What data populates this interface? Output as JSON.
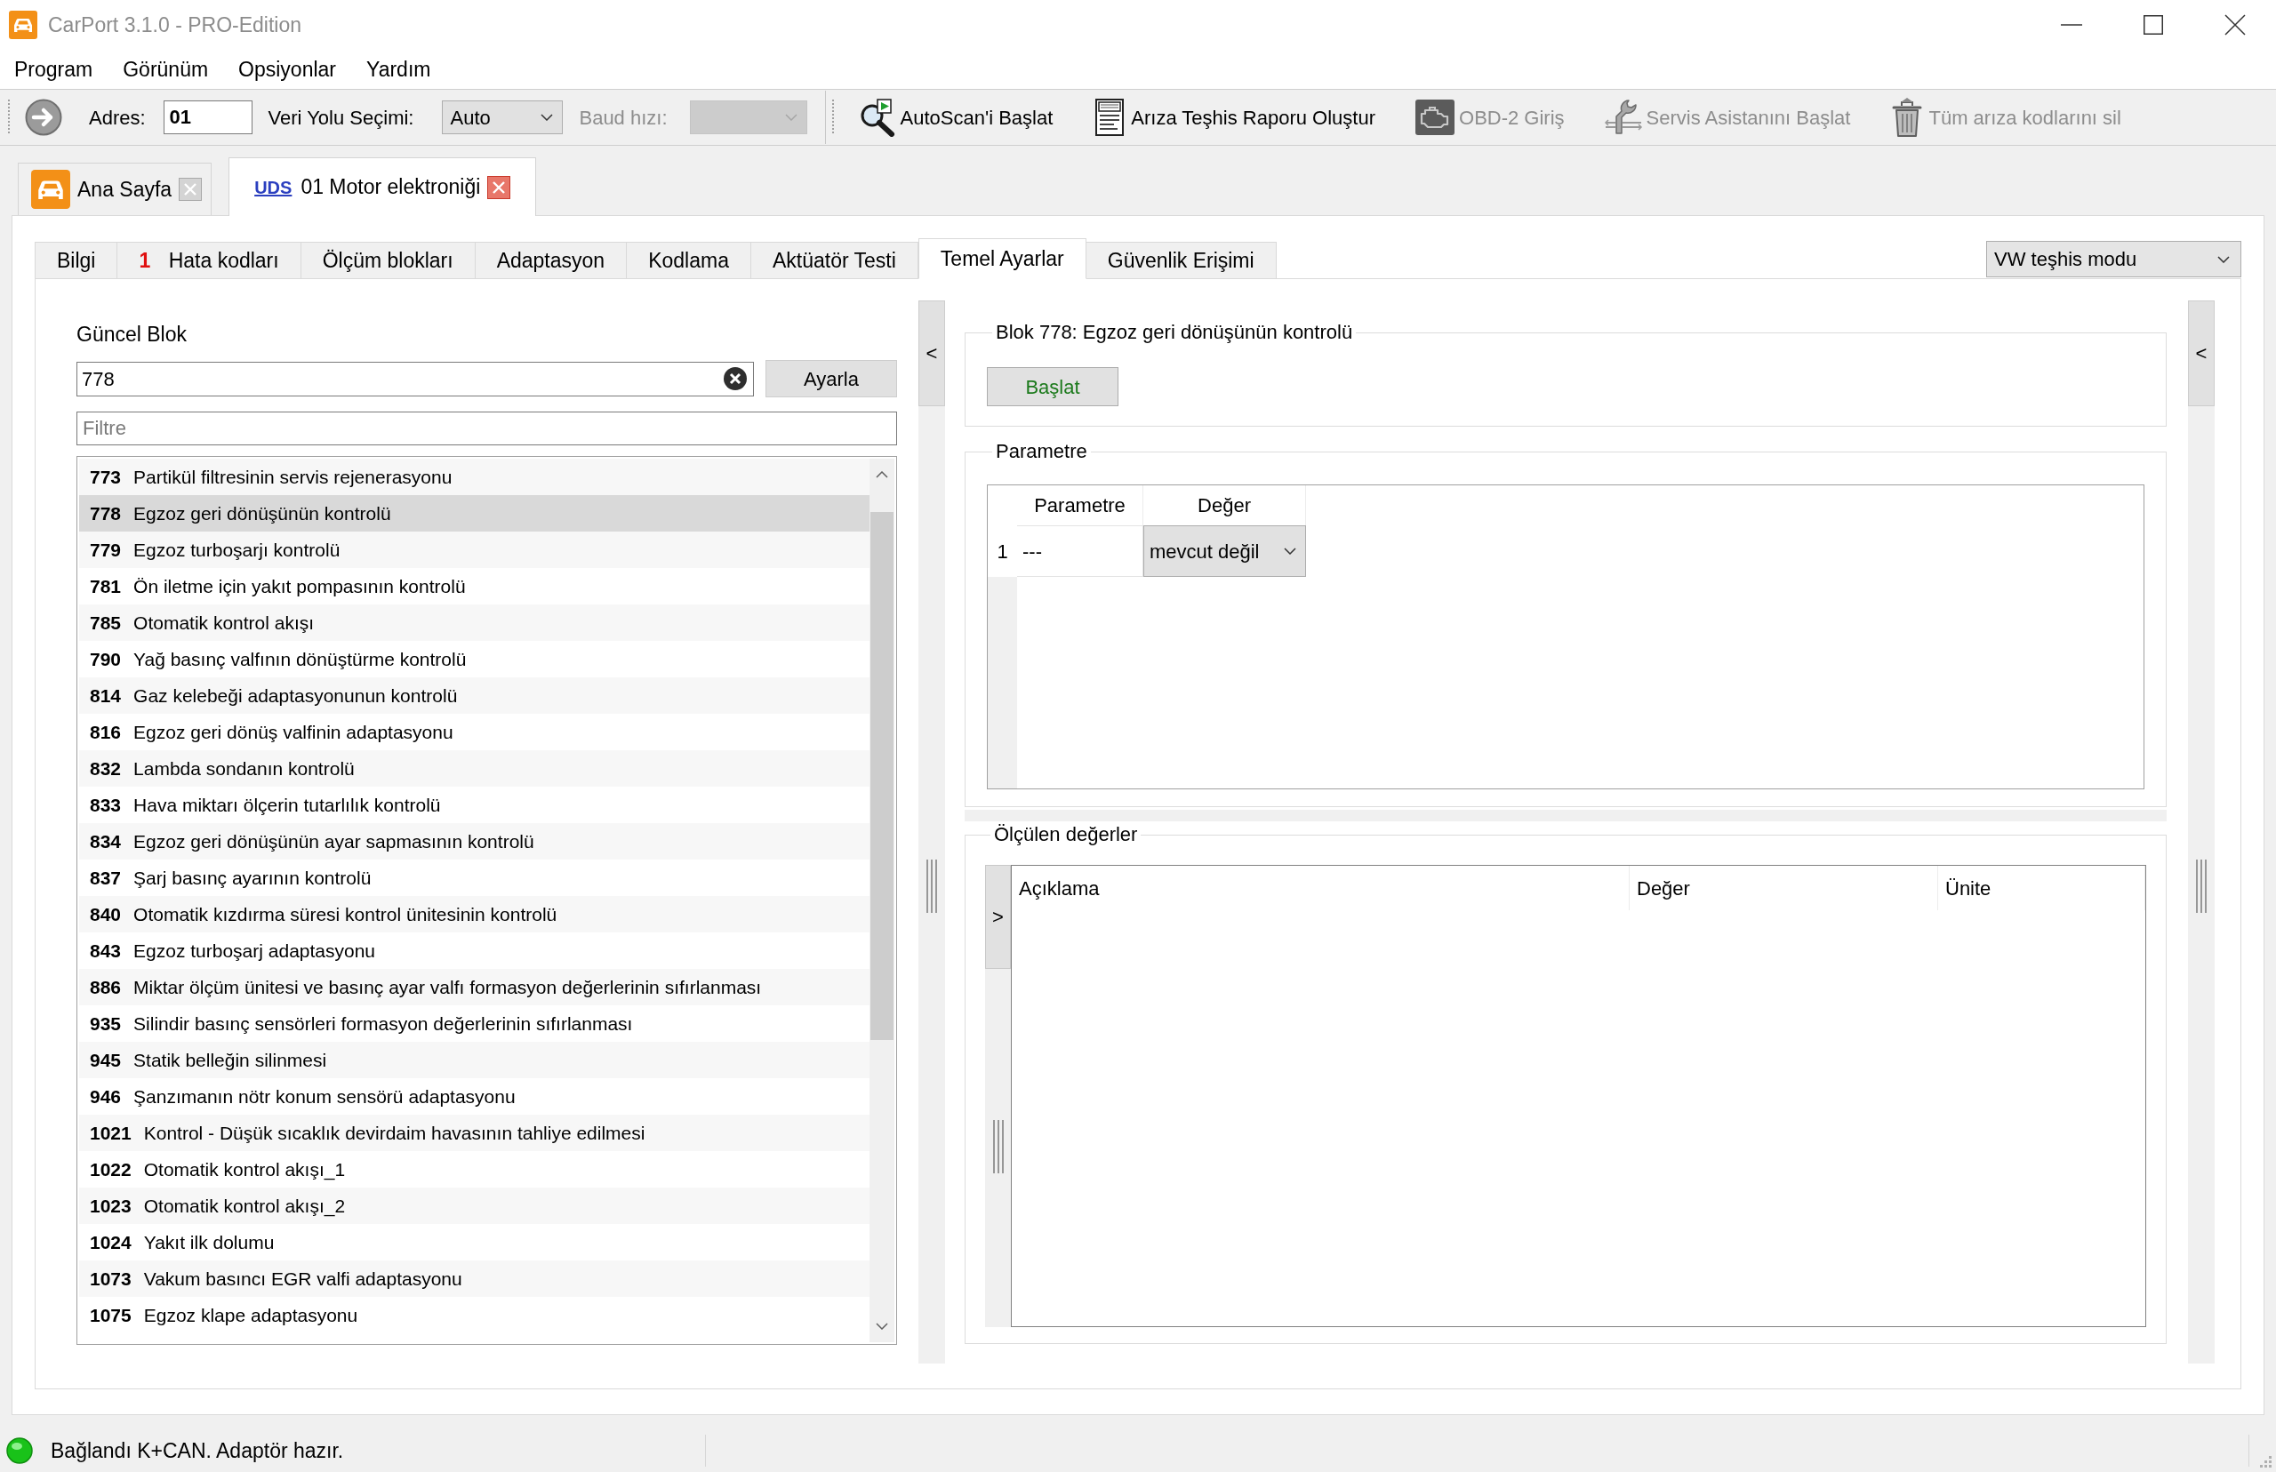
{
  "window": {
    "title": "CarPort 3.1.0 - PRO-Edition"
  },
  "menu": [
    {
      "label": "Program"
    },
    {
      "label": "Görünüm"
    },
    {
      "label": "Opsiyonlar"
    },
    {
      "label": "Yardım"
    }
  ],
  "toolbar": {
    "address": {
      "label": "Adres:",
      "value": "01"
    },
    "bus": {
      "label": "Veri Yolu Seçimi:",
      "value": "Auto"
    },
    "baud": {
      "label": "Baud hızı:",
      "disabled": true
    },
    "actions": [
      {
        "kind": "autoscan",
        "label": "AutoScan'i Başlat",
        "disabled": false
      },
      {
        "kind": "report",
        "label": "Arıza Teşhis Raporu Oluştur",
        "disabled": false
      },
      {
        "kind": "obd",
        "label": "OBD-2 Giriş",
        "disabled": true
      },
      {
        "kind": "service",
        "label": "Servis Asistanını Başlat",
        "disabled": true
      },
      {
        "kind": "clear",
        "label": "Tüm arıza kodlarını sil",
        "disabled": true
      }
    ]
  },
  "document_tabs": [
    {
      "kind": "home",
      "label": "Ana Sayfa",
      "selected": false
    },
    {
      "kind": "module",
      "protocol": "UDS",
      "label": "01 Motor elektroniği",
      "selected": true
    }
  ],
  "function_tabs": [
    {
      "label": "Bilgi",
      "selected": false
    },
    {
      "label": "Hata kodları",
      "count": "1",
      "selected": false
    },
    {
      "label": "Ölçüm blokları",
      "selected": false
    },
    {
      "label": "Adaptasyon",
      "selected": false
    },
    {
      "label": "Kodlama",
      "selected": false
    },
    {
      "label": "Aktüatör Testi",
      "selected": false
    },
    {
      "label": "Temel Ayarlar",
      "selected": true
    },
    {
      "label": "Güvenlik Erişimi",
      "selected": false
    }
  ],
  "mode_select": {
    "value": "VW teşhis modu"
  },
  "current_block": {
    "label": "Güncel Blok",
    "value": "778",
    "button": "Ayarla",
    "filter_placeholder": "Filtre"
  },
  "blocks": [
    {
      "number": "773",
      "name": "Partikül filtresinin servis rejenerasyonu",
      "selected": false
    },
    {
      "number": "778",
      "name": "Egzoz geri dönüşünün kontrolü",
      "selected": true
    },
    {
      "number": "779",
      "name": "Egzoz turboşarjı kontrolü",
      "selected": false
    },
    {
      "number": "781",
      "name": "Ön iletme için yakıt pompasının kontrolü",
      "selected": false
    },
    {
      "number": "785",
      "name": "Otomatik kontrol akışı",
      "selected": false
    },
    {
      "number": "790",
      "name": "Yağ basınç valfının dönüştürme kontrolü",
      "selected": false
    },
    {
      "number": "814",
      "name": "Gaz kelebeği adaptasyonunun kontrolü",
      "selected": false
    },
    {
      "number": "816",
      "name": "Egzoz geri dönüş valfinin adaptasyonu",
      "selected": false
    },
    {
      "number": "832",
      "name": "Lambda sondanın kontrolü",
      "selected": false
    },
    {
      "number": "833",
      "name": "Hava miktarı ölçerin tutarlılık kontrolü",
      "selected": false
    },
    {
      "number": "834",
      "name": "Egzoz geri dönüşünün ayar sapmasının kontrolü",
      "selected": false
    },
    {
      "number": "837",
      "name": "Şarj basınç ayarının kontrolü",
      "selected": false
    },
    {
      "number": "840",
      "name": "Otomatik kızdırma süresi kontrol ünitesinin kontrolü",
      "selected": false
    },
    {
      "number": "843",
      "name": "Egzoz turboşarj adaptasyonu",
      "selected": false
    },
    {
      "number": "886",
      "name": "Miktar ölçüm ünitesi ve basınç ayar valfı formasyon değerlerinin sıfırlanması",
      "selected": false
    },
    {
      "number": "935",
      "name": "Silindir basınç sensörleri formasyon değerlerinin sıfırlanması",
      "selected": false
    },
    {
      "number": "945",
      "name": "Statik belleğin silinmesi",
      "selected": false
    },
    {
      "number": "946",
      "name": "Şanzımanın nötr konum sensörü adaptasyonu",
      "selected": false
    },
    {
      "number": "1021",
      "name": "Kontrol - Düşük sıcaklık devirdaim havasının tahliye edilmesi",
      "selected": false
    },
    {
      "number": "1022",
      "name": "Otomatik kontrol akışı_1",
      "selected": false
    },
    {
      "number": "1023",
      "name": "Otomatik kontrol akışı_2",
      "selected": false
    },
    {
      "number": "1024",
      "name": "Yakıt ilk dolumu",
      "selected": false
    },
    {
      "number": "1073",
      "name": "Vakum basıncı EGR valfi adaptasyonu",
      "selected": false
    },
    {
      "number": "1075",
      "name": "Egzoz klape adaptasyonu",
      "selected": false
    }
  ],
  "left_splitter": {
    "button": "<"
  },
  "block_group": {
    "title": "Blok 778: Egzoz geri dönüşünün kontrolü",
    "start_button": "Başlat"
  },
  "parameter_group": {
    "title": "Parametre",
    "columns": [
      "Parametre",
      "Değer"
    ],
    "rows": [
      {
        "index": "1",
        "parameter": "---",
        "value": "mevcut değil"
      }
    ]
  },
  "measured_group": {
    "title": "Ölçülen değerler",
    "expand_button": ">",
    "columns": [
      "Açıklama",
      "Değer",
      "Ünite"
    ]
  },
  "right_splitter": {
    "button": "<"
  },
  "status_bar": {
    "connected": true,
    "message": "Bağlandı K+CAN. Adaptör hazır."
  }
}
